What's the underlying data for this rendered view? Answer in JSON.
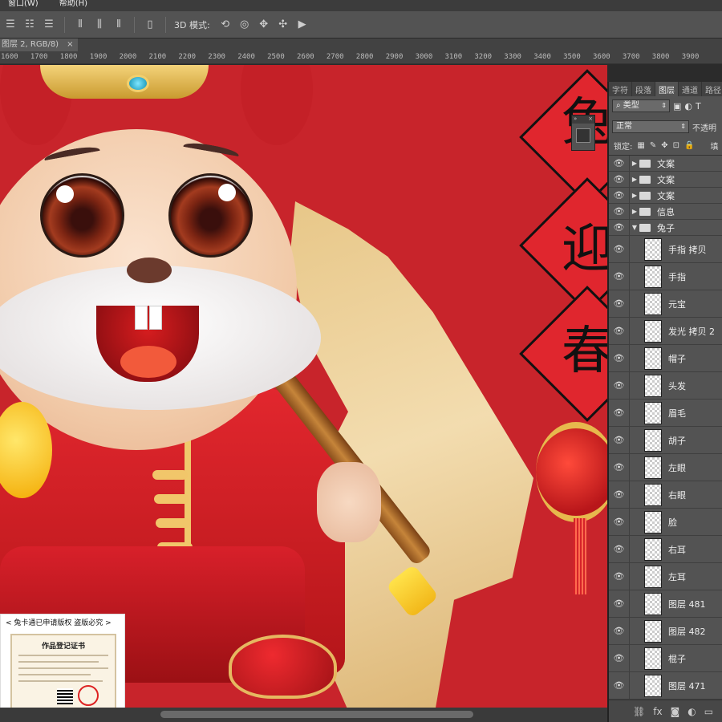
{
  "menu": {
    "items": [
      "窗口(W)",
      "帮助(H)"
    ]
  },
  "options_bar": {
    "mode_label": "3D 模式:"
  },
  "document_tab": {
    "title": "图层 2, RGB/8)",
    "close": "×"
  },
  "ruler": {
    "ticks": [
      "1600",
      "1700",
      "1800",
      "1900",
      "2000",
      "2100",
      "2200",
      "2300",
      "2400",
      "2500",
      "2600",
      "2700",
      "2800",
      "2900",
      "3000",
      "3100",
      "3200",
      "3300",
      "3400",
      "3500",
      "3600",
      "3700",
      "3800",
      "3900"
    ]
  },
  "artwork": {
    "poster_chars": [
      "兔",
      "迎",
      "春"
    ]
  },
  "copyright": {
    "caption": "< 兔卡通已申请版权 盗版必究 >",
    "cert_title": "作品登记证书"
  },
  "layers_panel": {
    "tabs": [
      "字符",
      "段落",
      "图层",
      "通道",
      "路径"
    ],
    "active_tab": "图层",
    "filter_label": "类型",
    "blend_mode": "正常",
    "opacity_label": "不透明",
    "lock_label": "锁定:",
    "fill_label": "填",
    "layers": [
      {
        "type": "folder",
        "name": "文案",
        "expanded": false
      },
      {
        "type": "folder",
        "name": "文案",
        "expanded": false
      },
      {
        "type": "folder",
        "name": "文案",
        "expanded": false
      },
      {
        "type": "folder",
        "name": "信息",
        "expanded": false
      },
      {
        "type": "folder",
        "name": "兔子",
        "expanded": true
      },
      {
        "type": "item",
        "name": "手指 拷贝"
      },
      {
        "type": "item",
        "name": "手指"
      },
      {
        "type": "item",
        "name": "元宝"
      },
      {
        "type": "item",
        "name": "发光 拷贝 2"
      },
      {
        "type": "item",
        "name": "帽子"
      },
      {
        "type": "item",
        "name": "头发"
      },
      {
        "type": "item",
        "name": "眉毛"
      },
      {
        "type": "item",
        "name": "胡子"
      },
      {
        "type": "item",
        "name": "左眼"
      },
      {
        "type": "item",
        "name": "右眼"
      },
      {
        "type": "item",
        "name": "脸"
      },
      {
        "type": "item",
        "name": "右耳"
      },
      {
        "type": "item",
        "name": "左耳"
      },
      {
        "type": "item",
        "name": "图层 481"
      },
      {
        "type": "item",
        "name": "图层 482"
      },
      {
        "type": "item",
        "name": "棍子"
      },
      {
        "type": "item",
        "name": "图层 471"
      }
    ],
    "footer_icons": [
      "link-icon",
      "fx-icon",
      "mask-icon",
      "adjustment-icon",
      "folder-icon"
    ]
  }
}
